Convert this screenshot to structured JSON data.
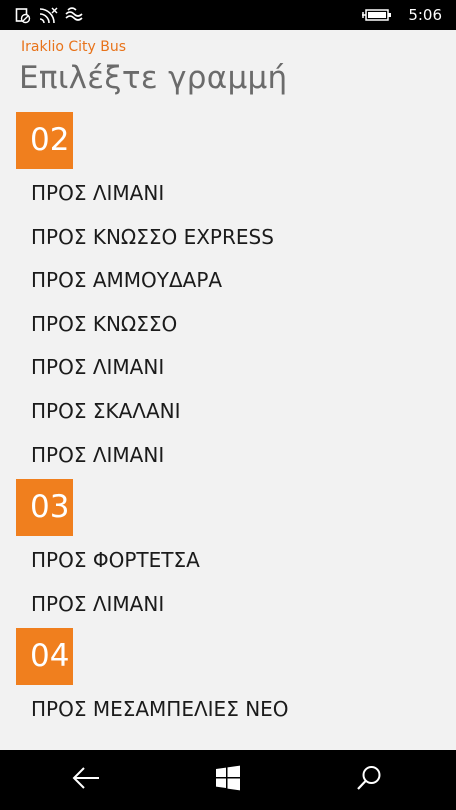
{
  "status_bar": {
    "icons": [
      "alarm-off-icon",
      "signal-icon",
      "wifi-icon",
      "battery-charging-icon"
    ],
    "time": "5:06"
  },
  "app": {
    "title": "Iraklio City Bus"
  },
  "page": {
    "title": "Επιλέξτε γραμμή"
  },
  "colors": {
    "accent": "#f07f1e",
    "app_title": "#e8731a",
    "page_title": "#6b6b6b",
    "background": "#f2f2f2",
    "text": "#1b1b1b"
  },
  "groups": [
    {
      "number": "02",
      "routes": [
        "ΠΡΟΣ ΛΙΜΑΝΙ",
        "ΠΡΟΣ ΚΝΩΣΣΟ EXPRESS",
        "ΠΡΟΣ ΑΜΜΟΥΔΑΡΑ",
        "ΠΡΟΣ ΚΝΩΣΣΟ",
        "ΠΡΟΣ ΛΙΜΑΝΙ",
        "ΠΡΟΣ ΣΚΑΛΑΝΙ",
        "ΠΡΟΣ ΛΙΜΑΝΙ"
      ]
    },
    {
      "number": "03",
      "routes": [
        "ΠΡΟΣ ΦΟΡΤΕΤΣΑ",
        "ΠΡΟΣ ΛΙΜΑΝΙ"
      ]
    },
    {
      "number": "04",
      "routes": [
        "ΠΡΟΣ ΜΕΣΑΜΠΕΛΙΕΣ ΝΕΟ"
      ]
    }
  ],
  "nav_bar": {
    "icons": [
      "back-arrow-icon",
      "windows-start-icon",
      "search-icon"
    ]
  }
}
